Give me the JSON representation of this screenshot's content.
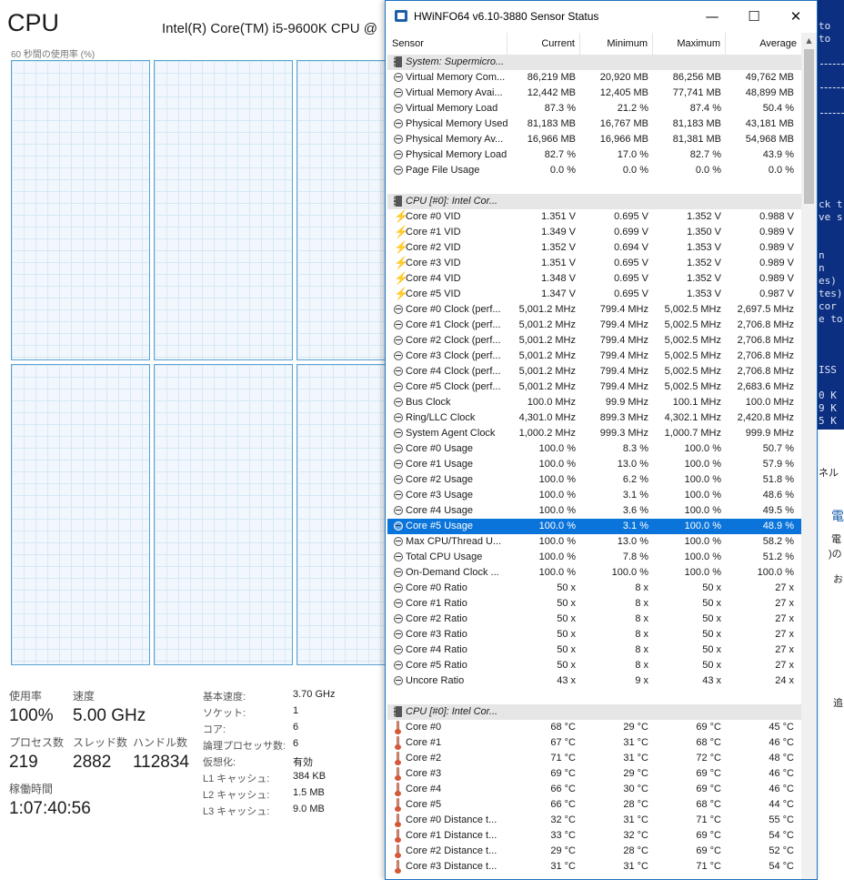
{
  "task_manager": {
    "title": "CPU",
    "cpu_name": "Intel(R) Core(TM) i5-9600K CPU @",
    "graph_label": "60 秒間の使用率 (%)",
    "stats": {
      "usage_label": "使用率",
      "usage_value": "100%",
      "speed_label": "速度",
      "speed_value": "5.00 GHz",
      "processes_label": "プロセス数",
      "processes_value": "219",
      "threads_label": "スレッド数",
      "threads_value": "2882",
      "handles_label": "ハンドル数",
      "handles_value": "112834",
      "uptime_label": "稼働時間",
      "uptime_value": "1:07:40:56"
    },
    "specs": [
      {
        "label": "基本速度:",
        "value": "3.70 GHz"
      },
      {
        "label": "ソケット:",
        "value": "1"
      },
      {
        "label": "コア:",
        "value": "6"
      },
      {
        "label": "論理プロセッサ数:",
        "value": "6"
      },
      {
        "label": "仮想化:",
        "value": "有効"
      },
      {
        "label": "L1 キャッシュ:",
        "value": "384 KB"
      },
      {
        "label": "L2 キャッシュ:",
        "value": "1.5 MB"
      },
      {
        "label": "L3 キャッシュ:",
        "value": "9.0 MB"
      }
    ]
  },
  "console": {
    "lines": [
      "to",
      "to",
      "ck t",
      "ve s",
      "n",
      "n",
      "es)",
      "tes)",
      " cor",
      "e to",
      "ISS",
      "0 K",
      "9 K",
      "5 K"
    ]
  },
  "bg_fragments": [
    "ネル",
    "電",
    "電",
    ")の",
    "お",
    "追"
  ],
  "hwinfo": {
    "title": "HWiNFO64 v6.10-3880 Sensor Status",
    "buttons": {
      "minimize": "—",
      "maximize": "☐",
      "close": "✕"
    },
    "columns": [
      "Sensor",
      "Current",
      "Minimum",
      "Maximum",
      "Average"
    ],
    "rows": [
      {
        "type": "group",
        "name": "System: Supermicro..."
      },
      {
        "type": "gauge",
        "name": "Virtual Memory Com...",
        "cur": "86,219 MB",
        "min": "20,920 MB",
        "max": "86,256 MB",
        "avg": "49,762 MB"
      },
      {
        "type": "gauge",
        "name": "Virtual Memory Avai...",
        "cur": "12,442 MB",
        "min": "12,405 MB",
        "max": "77,741 MB",
        "avg": "48,899 MB"
      },
      {
        "type": "gauge",
        "name": "Virtual Memory Load",
        "cur": "87.3 %",
        "min": "21.2 %",
        "max": "87.4 %",
        "avg": "50.4 %"
      },
      {
        "type": "gauge",
        "name": "Physical Memory Used",
        "cur": "81,183 MB",
        "min": "16,767 MB",
        "max": "81,183 MB",
        "avg": "43,181 MB"
      },
      {
        "type": "gauge",
        "name": "Physical Memory Av...",
        "cur": "16,966 MB",
        "min": "16,966 MB",
        "max": "81,381 MB",
        "avg": "54,968 MB"
      },
      {
        "type": "gauge",
        "name": "Physical Memory Load",
        "cur": "82.7 %",
        "min": "17.0 %",
        "max": "82.7 %",
        "avg": "43.9 %"
      },
      {
        "type": "gauge",
        "name": "Page File Usage",
        "cur": "0.0 %",
        "min": "0.0 %",
        "max": "0.0 %",
        "avg": "0.0 %"
      },
      {
        "type": "blank"
      },
      {
        "type": "group",
        "name": "CPU [#0]: Intel Cor..."
      },
      {
        "type": "volt",
        "name": "Core #0 VID",
        "cur": "1.351 V",
        "min": "0.695 V",
        "max": "1.352 V",
        "avg": "0.988 V"
      },
      {
        "type": "volt",
        "name": "Core #1 VID",
        "cur": "1.349 V",
        "min": "0.699 V",
        "max": "1.350 V",
        "avg": "0.989 V"
      },
      {
        "type": "volt",
        "name": "Core #2 VID",
        "cur": "1.352 V",
        "min": "0.694 V",
        "max": "1.353 V",
        "avg": "0.989 V"
      },
      {
        "type": "volt",
        "name": "Core #3 VID",
        "cur": "1.351 V",
        "min": "0.695 V",
        "max": "1.352 V",
        "avg": "0.989 V"
      },
      {
        "type": "volt",
        "name": "Core #4 VID",
        "cur": "1.348 V",
        "min": "0.695 V",
        "max": "1.352 V",
        "avg": "0.989 V"
      },
      {
        "type": "volt",
        "name": "Core #5 VID",
        "cur": "1.347 V",
        "min": "0.695 V",
        "max": "1.353 V",
        "avg": "0.987 V"
      },
      {
        "type": "gauge",
        "name": "Core #0 Clock (perf...",
        "cur": "5,001.2 MHz",
        "min": "799.4 MHz",
        "max": "5,002.5 MHz",
        "avg": "2,697.5 MHz"
      },
      {
        "type": "gauge",
        "name": "Core #1 Clock (perf...",
        "cur": "5,001.2 MHz",
        "min": "799.4 MHz",
        "max": "5,002.5 MHz",
        "avg": "2,706.8 MHz"
      },
      {
        "type": "gauge",
        "name": "Core #2 Clock (perf...",
        "cur": "5,001.2 MHz",
        "min": "799.4 MHz",
        "max": "5,002.5 MHz",
        "avg": "2,706.8 MHz"
      },
      {
        "type": "gauge",
        "name": "Core #3 Clock (perf...",
        "cur": "5,001.2 MHz",
        "min": "799.4 MHz",
        "max": "5,002.5 MHz",
        "avg": "2,706.8 MHz"
      },
      {
        "type": "gauge",
        "name": "Core #4 Clock (perf...",
        "cur": "5,001.2 MHz",
        "min": "799.4 MHz",
        "max": "5,002.5 MHz",
        "avg": "2,706.8 MHz"
      },
      {
        "type": "gauge",
        "name": "Core #5 Clock (perf...",
        "cur": "5,001.2 MHz",
        "min": "799.4 MHz",
        "max": "5,002.5 MHz",
        "avg": "2,683.6 MHz"
      },
      {
        "type": "gauge",
        "name": "Bus Clock",
        "cur": "100.0 MHz",
        "min": "99.9 MHz",
        "max": "100.1 MHz",
        "avg": "100.0 MHz"
      },
      {
        "type": "gauge",
        "name": "Ring/LLC Clock",
        "cur": "4,301.0 MHz",
        "min": "899.3 MHz",
        "max": "4,302.1 MHz",
        "avg": "2,420.8 MHz"
      },
      {
        "type": "gauge",
        "name": "System Agent Clock",
        "cur": "1,000.2 MHz",
        "min": "999.3 MHz",
        "max": "1,000.7 MHz",
        "avg": "999.9 MHz"
      },
      {
        "type": "gauge",
        "name": "Core #0 Usage",
        "cur": "100.0 %",
        "min": "8.3 %",
        "max": "100.0 %",
        "avg": "50.7 %"
      },
      {
        "type": "gauge",
        "name": "Core #1 Usage",
        "cur": "100.0 %",
        "min": "13.0 %",
        "max": "100.0 %",
        "avg": "57.9 %"
      },
      {
        "type": "gauge",
        "name": "Core #2 Usage",
        "cur": "100.0 %",
        "min": "6.2 %",
        "max": "100.0 %",
        "avg": "51.8 %"
      },
      {
        "type": "gauge",
        "name": "Core #3 Usage",
        "cur": "100.0 %",
        "min": "3.1 %",
        "max": "100.0 %",
        "avg": "48.6 %"
      },
      {
        "type": "gauge",
        "name": "Core #4 Usage",
        "cur": "100.0 %",
        "min": "3.6 %",
        "max": "100.0 %",
        "avg": "49.5 %"
      },
      {
        "type": "gauge",
        "name": "Core #5 Usage",
        "cur": "100.0 %",
        "min": "3.1 %",
        "max": "100.0 %",
        "avg": "48.9 %",
        "selected": true
      },
      {
        "type": "gauge",
        "name": "Max CPU/Thread U...",
        "cur": "100.0 %",
        "min": "13.0 %",
        "max": "100.0 %",
        "avg": "58.2 %"
      },
      {
        "type": "gauge",
        "name": "Total CPU Usage",
        "cur": "100.0 %",
        "min": "7.8 %",
        "max": "100.0 %",
        "avg": "51.2 %"
      },
      {
        "type": "gauge",
        "name": "On-Demand Clock ...",
        "cur": "100.0 %",
        "min": "100.0 %",
        "max": "100.0 %",
        "avg": "100.0 %"
      },
      {
        "type": "gauge",
        "name": "Core #0 Ratio",
        "cur": "50 x",
        "min": "8 x",
        "max": "50 x",
        "avg": "27 x"
      },
      {
        "type": "gauge",
        "name": "Core #1 Ratio",
        "cur": "50 x",
        "min": "8 x",
        "max": "50 x",
        "avg": "27 x"
      },
      {
        "type": "gauge",
        "name": "Core #2 Ratio",
        "cur": "50 x",
        "min": "8 x",
        "max": "50 x",
        "avg": "27 x"
      },
      {
        "type": "gauge",
        "name": "Core #3 Ratio",
        "cur": "50 x",
        "min": "8 x",
        "max": "50 x",
        "avg": "27 x"
      },
      {
        "type": "gauge",
        "name": "Core #4 Ratio",
        "cur": "50 x",
        "min": "8 x",
        "max": "50 x",
        "avg": "27 x"
      },
      {
        "type": "gauge",
        "name": "Core #5 Ratio",
        "cur": "50 x",
        "min": "8 x",
        "max": "50 x",
        "avg": "27 x"
      },
      {
        "type": "gauge",
        "name": "Uncore Ratio",
        "cur": "43 x",
        "min": "9 x",
        "max": "43 x",
        "avg": "24 x"
      },
      {
        "type": "blank"
      },
      {
        "type": "group",
        "name": "CPU [#0]: Intel Cor..."
      },
      {
        "type": "temp",
        "name": "Core #0",
        "cur": "68 °C",
        "min": "29 °C",
        "max": "69 °C",
        "avg": "45 °C"
      },
      {
        "type": "temp",
        "name": "Core #1",
        "cur": "67 °C",
        "min": "31 °C",
        "max": "68 °C",
        "avg": "46 °C"
      },
      {
        "type": "temp",
        "name": "Core #2",
        "cur": "71 °C",
        "min": "31 °C",
        "max": "72 °C",
        "avg": "48 °C"
      },
      {
        "type": "temp",
        "name": "Core #3",
        "cur": "69 °C",
        "min": "29 °C",
        "max": "69 °C",
        "avg": "46 °C"
      },
      {
        "type": "temp",
        "name": "Core #4",
        "cur": "66 °C",
        "min": "30 °C",
        "max": "69 °C",
        "avg": "46 °C"
      },
      {
        "type": "temp",
        "name": "Core #5",
        "cur": "66 °C",
        "min": "28 °C",
        "max": "68 °C",
        "avg": "44 °C"
      },
      {
        "type": "temp",
        "name": "Core #0 Distance t...",
        "cur": "32 °C",
        "min": "31 °C",
        "max": "71 °C",
        "avg": "55 °C"
      },
      {
        "type": "temp",
        "name": "Core #1 Distance t...",
        "cur": "33 °C",
        "min": "32 °C",
        "max": "69 °C",
        "avg": "54 °C"
      },
      {
        "type": "temp",
        "name": "Core #2 Distance t...",
        "cur": "29 °C",
        "min": "28 °C",
        "max": "69 °C",
        "avg": "52 °C"
      },
      {
        "type": "temp",
        "name": "Core #3 Distance t...",
        "cur": "31 °C",
        "min": "31 °C",
        "max": "71 °C",
        "avg": "54 °C"
      }
    ]
  }
}
